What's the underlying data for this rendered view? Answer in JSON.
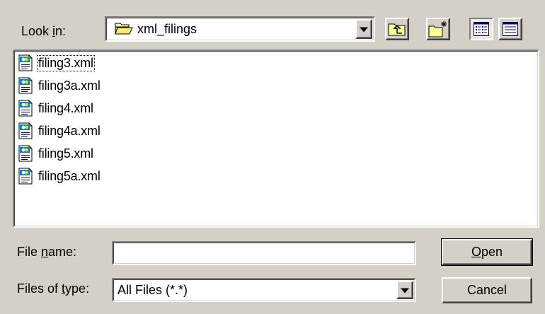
{
  "look_in": {
    "label_pre": "Look ",
    "label_key": "i",
    "label_post": "n:",
    "value": "xml_filings",
    "folder_icon": "folder-open-icon",
    "dropdown_icon": "chevron-down-icon"
  },
  "toolbar": {
    "up_icon": "up-one-level-icon",
    "new_folder_icon": "new-folder-icon",
    "list_view_icon": "list-view-icon",
    "details_view_icon": "details-view-icon"
  },
  "files": [
    {
      "name": "filing3.xml",
      "icon": "xml-file-icon"
    },
    {
      "name": "filing3a.xml",
      "icon": "xml-file-icon"
    },
    {
      "name": "filing4.xml",
      "icon": "xml-file-icon"
    },
    {
      "name": "filing4a.xml",
      "icon": "xml-file-icon"
    },
    {
      "name": "filing5.xml",
      "icon": "xml-file-icon"
    },
    {
      "name": "filing5a.xml",
      "icon": "xml-file-icon"
    }
  ],
  "file_name": {
    "label_pre": "File ",
    "label_key": "n",
    "label_post": "ame:",
    "value": ""
  },
  "file_type": {
    "label_pre": "Files of ",
    "label_key": "t",
    "label_post": "ype:",
    "value": "All Files (*.*)"
  },
  "buttons": {
    "open_key": "O",
    "open_rest": "pen",
    "cancel": "Cancel"
  },
  "colors": {
    "face": "#d4d0c8",
    "window": "#ffffff"
  }
}
